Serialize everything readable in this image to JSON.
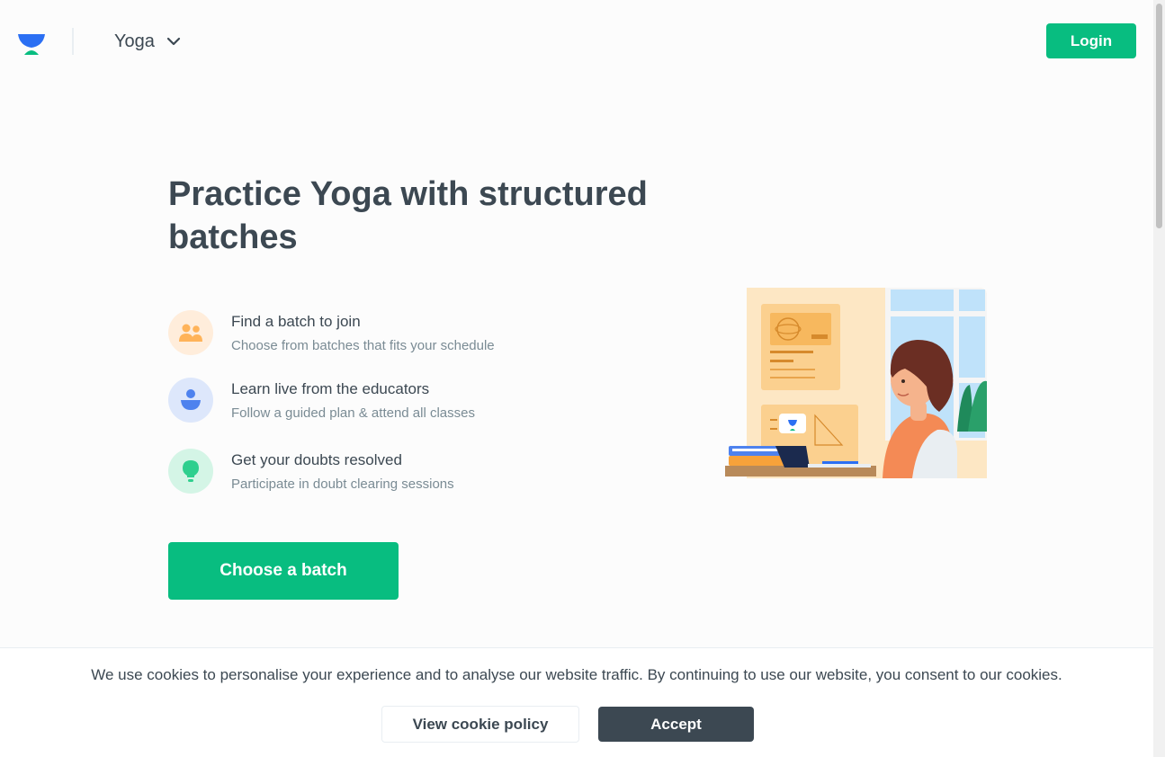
{
  "header": {
    "logo_icon": "unacademy-logo-icon",
    "goal": "Yoga",
    "goal_chevron_icon": "chevron-down-icon",
    "login_label": "Login"
  },
  "hero": {
    "headline": "Practice Yoga with structured batches",
    "features": [
      {
        "icon": "group-icon",
        "title": "Find a batch to join",
        "subtitle": "Choose from batches that fits your schedule",
        "color": "#ffb359",
        "bg": "#ffeddb"
      },
      {
        "icon": "educator-icon",
        "title": "Learn live from the educators",
        "subtitle": "Follow a guided plan & attend all classes",
        "color": "#4e82ee",
        "bg": "#dde7fb"
      },
      {
        "icon": "lightbulb-icon",
        "title": "Get your doubts resolved",
        "subtitle": "Participate in doubt clearing sessions",
        "color": "#2fcf8e",
        "bg": "#d4f5e6"
      }
    ],
    "cta_label": "Choose a batch",
    "illustration": "learner-at-desk-illustration"
  },
  "cookie_bar": {
    "message": "We use cookies to personalise your experience and to analyse our website traffic. By continuing to use our website, you consent to our cookies.",
    "policy_label": "View cookie policy",
    "accept_label": "Accept"
  },
  "colors": {
    "brand_green": "#08bd80",
    "text_dark": "#3c4852",
    "text_muted": "#7a8b94"
  }
}
